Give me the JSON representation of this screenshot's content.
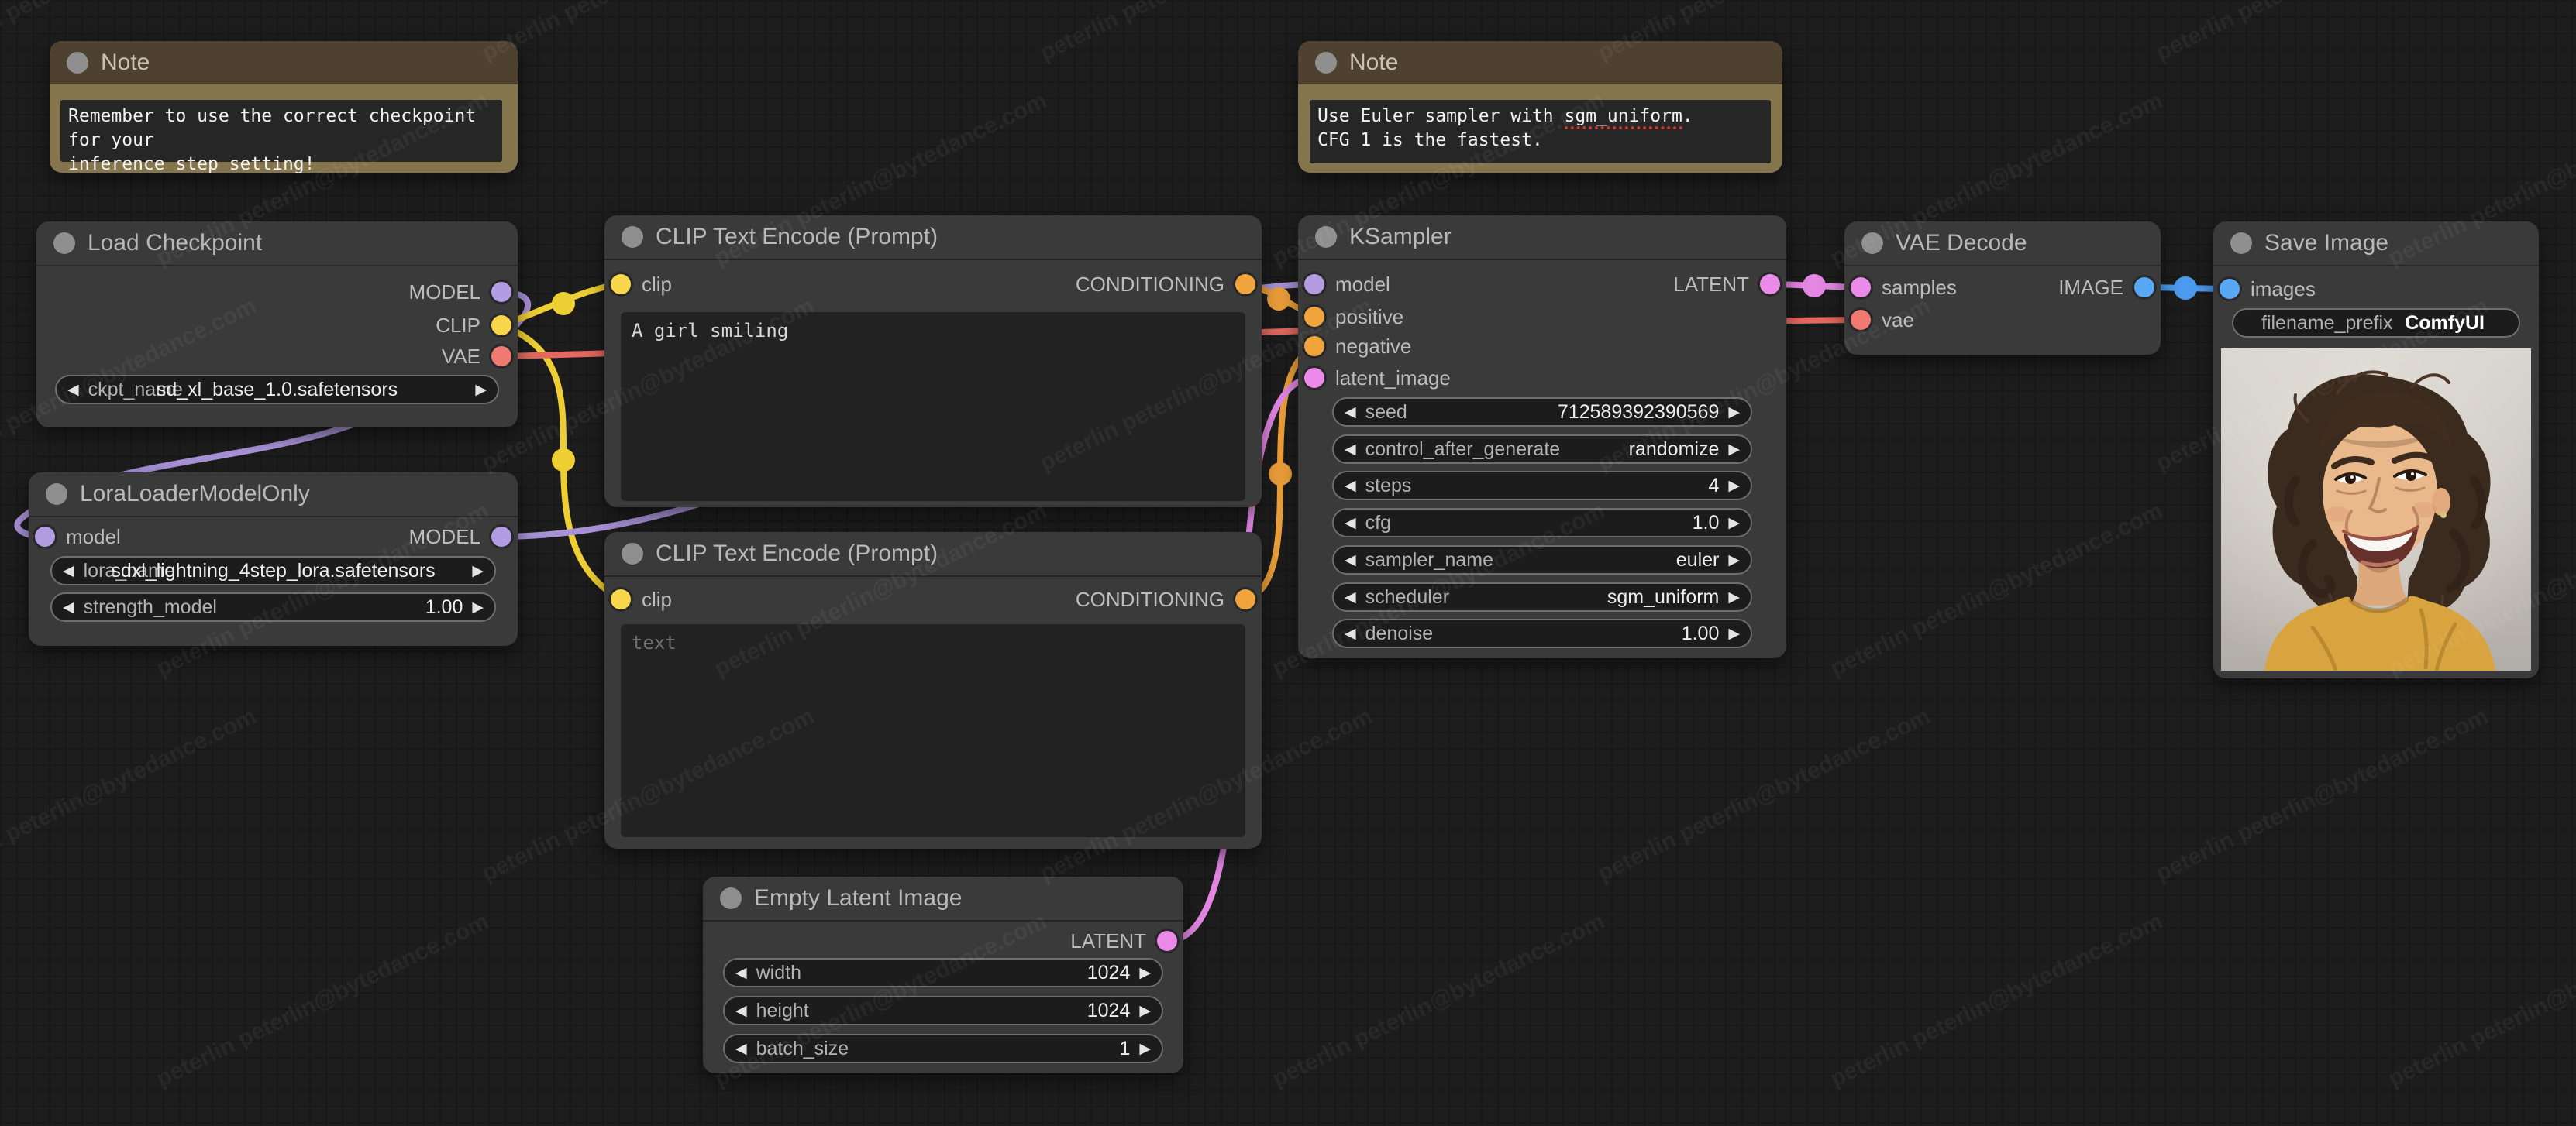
{
  "icons": {
    "arrow_left": "◀",
    "arrow_right": "▶"
  },
  "colors": {
    "model": "#b49ce3",
    "clip": "#f8d64b",
    "vae": "#f07a72",
    "conditioning": "#f2a43c",
    "latent": "#ea8bea",
    "image": "#58a8f4",
    "wire_model": "#a892d6",
    "wire_clip": "#eecf33",
    "wire_vae": "#e3685f",
    "wire_conditioning": "#eda03b",
    "wire_latent": "#e387e3",
    "wire_image": "#4d9bf0",
    "title_dot": "#8f8f8f",
    "note_header": "#4e4130",
    "note_body": "#85754c",
    "accent_misspell": "#cc3333"
  },
  "watermark": {
    "text": "peterlin peterlin@bytedance.com"
  },
  "nodes": {
    "note1": {
      "title": "Note",
      "text": "Remember to use the correct checkpoint for your\ninference step setting!"
    },
    "note2": {
      "title": "Note",
      "text_before": "Use Euler sampler with ",
      "text_underlined": "sgm_uniform",
      "text_after": ".",
      "line2": "CFG 1 is the fastest."
    },
    "load_checkpoint": {
      "title": "Load Checkpoint",
      "outputs": [
        {
          "label": "MODEL"
        },
        {
          "label": "CLIP"
        },
        {
          "label": "VAE"
        }
      ],
      "widgets": [
        {
          "label": "ckpt_name",
          "value": "sd_xl_base_1.0.safetensors"
        }
      ]
    },
    "lora_loader": {
      "title": "LoraLoaderModelOnly",
      "inputs": [
        {
          "label": "model"
        }
      ],
      "outputs": [
        {
          "label": "MODEL"
        }
      ],
      "widgets": [
        {
          "label": "lora_name",
          "value": "sdxl_lightning_4step_lora.safetensors"
        },
        {
          "label": "strength_model",
          "value": "1.00"
        }
      ]
    },
    "clip_encode_positive": {
      "title": "CLIP Text Encode (Prompt)",
      "inputs": [
        {
          "label": "clip"
        }
      ],
      "outputs": [
        {
          "label": "CONDITIONING"
        }
      ],
      "text": "A girl smiling"
    },
    "clip_encode_negative": {
      "title": "CLIP Text Encode (Prompt)",
      "inputs": [
        {
          "label": "clip"
        }
      ],
      "outputs": [
        {
          "label": "CONDITIONING"
        }
      ],
      "placeholder": "text"
    },
    "ksampler": {
      "title": "KSampler",
      "inputs": [
        {
          "label": "model"
        },
        {
          "label": "positive"
        },
        {
          "label": "negative"
        },
        {
          "label": "latent_image"
        }
      ],
      "outputs": [
        {
          "label": "LATENT"
        }
      ],
      "widgets": [
        {
          "label": "seed",
          "value": "712589392390569"
        },
        {
          "label": "control_after_generate",
          "value": "randomize"
        },
        {
          "label": "steps",
          "value": "4"
        },
        {
          "label": "cfg",
          "value": "1.0"
        },
        {
          "label": "sampler_name",
          "value": "euler"
        },
        {
          "label": "scheduler",
          "value": "sgm_uniform"
        },
        {
          "label": "denoise",
          "value": "1.00"
        }
      ]
    },
    "vae_decode": {
      "title": "VAE Decode",
      "inputs": [
        {
          "label": "samples"
        },
        {
          "label": "vae"
        }
      ],
      "outputs": [
        {
          "label": "IMAGE"
        }
      ]
    },
    "save_image": {
      "title": "Save Image",
      "inputs": [
        {
          "label": "images"
        }
      ],
      "widgets": [
        {
          "label": "filename_prefix",
          "value": "ComfyUI"
        }
      ]
    },
    "empty_latent": {
      "title": "Empty Latent Image",
      "outputs": [
        {
          "label": "LATENT"
        }
      ],
      "widgets": [
        {
          "label": "width",
          "value": "1024"
        },
        {
          "label": "height",
          "value": "1024"
        },
        {
          "label": "batch_size",
          "value": "1"
        }
      ]
    }
  }
}
